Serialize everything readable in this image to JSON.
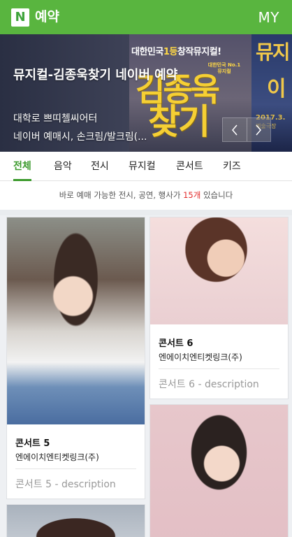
{
  "header": {
    "logo_letter": "N",
    "title": "예약",
    "my_label": "MY"
  },
  "banner": {
    "title": "뮤지컬-김종욱찾기 네이버 예약",
    "venue": "대학로 쁘띠첼씨어터",
    "booking": "네이버 예매시, 손크림/발크림(...",
    "art": {
      "top_prefix": "대한민국",
      "top_highlight": "1등",
      "top_suffix": "창작뮤지컬!",
      "small_text": "대한민국 No.1 뮤지컬",
      "big_line1": "김종욱",
      "big_line2": "찾기",
      "right_text1": "뮤지",
      "right_text2": "이",
      "right_date": "2017.3.",
      "right_venue": "예술극장"
    },
    "prev_label": "prev",
    "next_label": "next"
  },
  "tabs": [
    {
      "label": "전체",
      "active": true
    },
    {
      "label": "음악",
      "active": false
    },
    {
      "label": "전시",
      "active": false
    },
    {
      "label": "뮤지컬",
      "active": false
    },
    {
      "label": "콘서트",
      "active": false
    },
    {
      "label": "키즈",
      "active": false
    }
  ],
  "info": {
    "prefix": "바로 예매 가능한 전시, 공연, 행사가 ",
    "count": "15개",
    "suffix": " 있습니다"
  },
  "cards": [
    {
      "title": "콘서트 5",
      "org": "엔에이치엔티켓링크(주)",
      "desc": "콘서트 5 - description"
    },
    {
      "title": "콘서트 6",
      "org": "엔에이치엔티켓링크(주)",
      "desc": "콘서트 6 - description"
    }
  ],
  "colors": {
    "brand": "#59b53f",
    "active_tab": "#3b9a2c",
    "count": "#e32b2b"
  },
  "icons": {
    "prev": "chevron-left-icon",
    "next": "chevron-right-icon"
  }
}
